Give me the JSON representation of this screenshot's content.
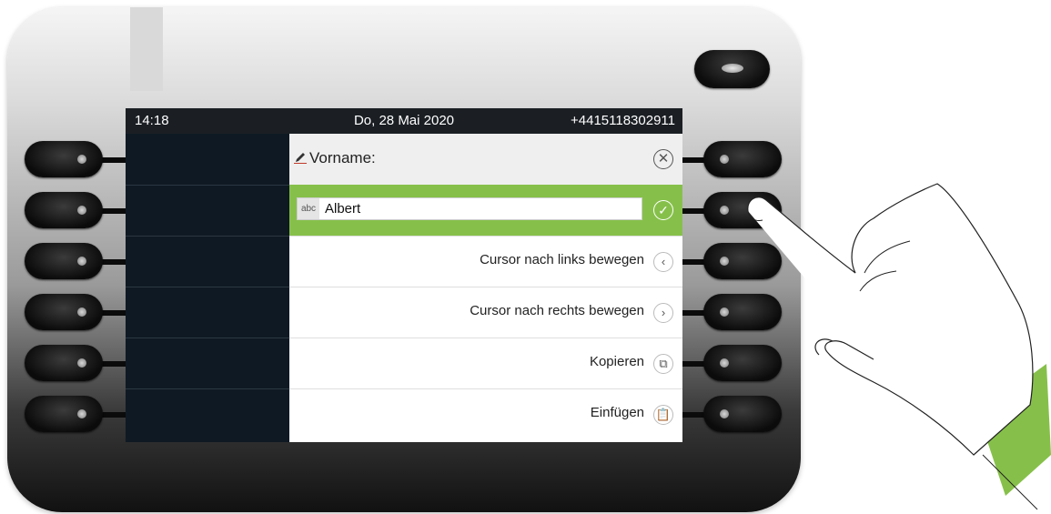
{
  "statusbar": {
    "time": "14:18",
    "date": "Do, 28 Mai 2020",
    "number": "+4415118302911"
  },
  "dialog": {
    "title": "Vorname:",
    "title_icon": "pencil-icon",
    "close_icon": "close-circle-icon",
    "input_prefix": "abc",
    "input_value": "Albert",
    "confirm_icon": "check-circle-icon",
    "options": [
      {
        "label": "Cursor nach links bewegen",
        "icon": "chevron-left-icon",
        "glyph": "‹"
      },
      {
        "label": "Cursor nach rechts bewegen",
        "icon": "chevron-right-icon",
        "glyph": "›"
      },
      {
        "label": "Kopieren",
        "icon": "copy-icon",
        "glyph": "⧉"
      },
      {
        "label": "Einfügen",
        "icon": "paste-icon",
        "glyph": "📋"
      }
    ]
  },
  "colors": {
    "accent_green": "#86c04a",
    "screen_bg": "#0f1a24",
    "statusbar_bg": "#1b1f24"
  }
}
